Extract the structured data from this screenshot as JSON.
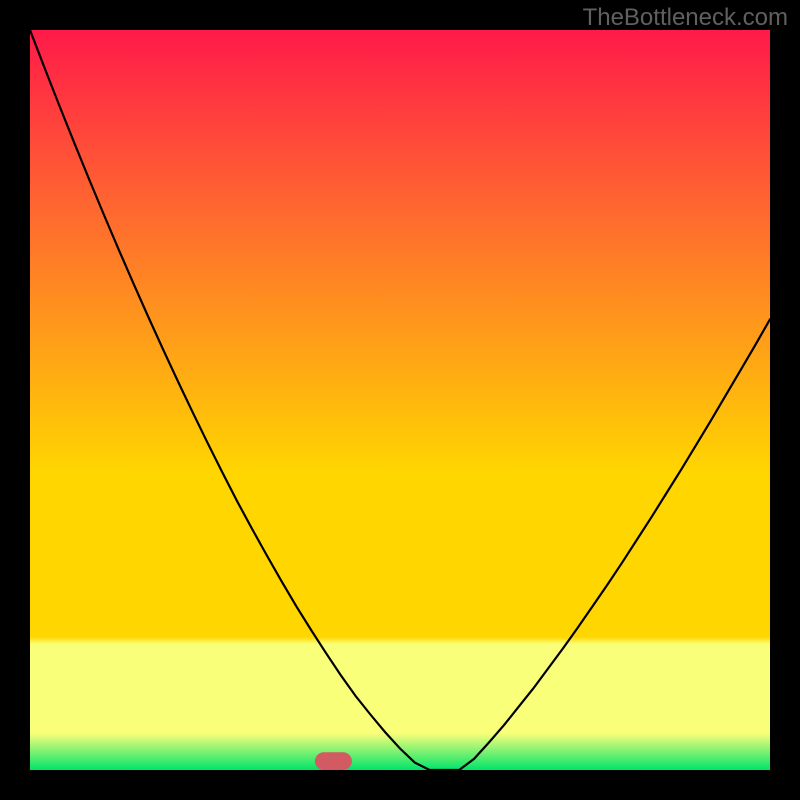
{
  "watermark": "TheBottleneck.com",
  "chart_data": {
    "type": "line",
    "title": "",
    "xlabel": "",
    "ylabel": "",
    "xlim": [
      0,
      100
    ],
    "ylim": [
      0,
      100
    ],
    "x": [
      0,
      2,
      4,
      6,
      8,
      10,
      12,
      14,
      16,
      18,
      20,
      22,
      24,
      26,
      28,
      30,
      32,
      34,
      36,
      38,
      40,
      42,
      44,
      46,
      48,
      50,
      52,
      54,
      56,
      58,
      60,
      62,
      64,
      66,
      68,
      70,
      72,
      74,
      76,
      78,
      80,
      82,
      84,
      86,
      88,
      90,
      92,
      94,
      96,
      98,
      100
    ],
    "y": [
      100,
      94.8,
      89.7,
      84.7,
      79.8,
      75.0,
      70.3,
      65.7,
      61.2,
      56.8,
      52.5,
      48.3,
      44.2,
      40.2,
      36.3,
      32.6,
      29.0,
      25.5,
      22.1,
      18.9,
      15.8,
      12.8,
      10.0,
      7.5,
      5.1,
      2.9,
      1.0,
      0.0,
      0.0,
      0.0,
      1.5,
      3.7,
      6.0,
      8.5,
      11.0,
      13.7,
      16.4,
      19.2,
      22.1,
      25.0,
      28.0,
      31.1,
      34.2,
      37.4,
      40.6,
      43.9,
      47.2,
      50.6,
      54.0,
      57.4,
      60.9
    ],
    "marker": {
      "x_center": 41.0,
      "width": 5.0,
      "height": 2.4
    },
    "colors": {
      "gradient_top": "#ff1a49",
      "gradient_mid_upper": "#ff6a2f",
      "gradient_mid": "#ffd600",
      "gradient_band": "#faff7a",
      "gradient_bottom": "#00e46a",
      "curve": "#000000",
      "marker": "#d15a63"
    }
  }
}
